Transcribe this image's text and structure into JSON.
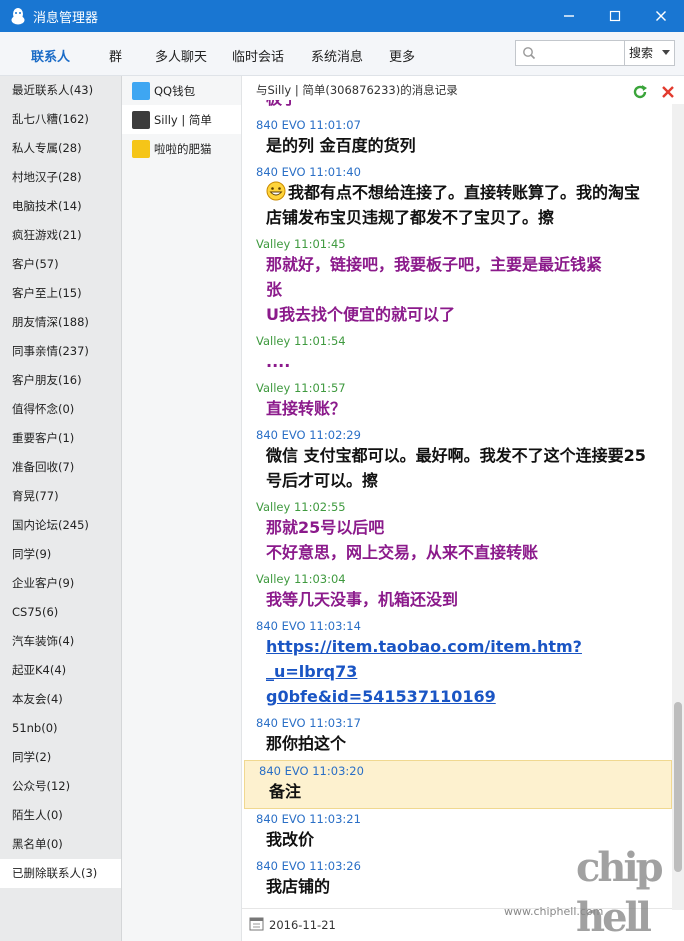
{
  "window": {
    "title": "消息管理器",
    "minimize": "—",
    "restore": "❐",
    "close": "✕"
  },
  "toolbar": {
    "tabs": [
      "联系人",
      "群",
      "多人聊天",
      "临时会话",
      "系统消息",
      "更多"
    ],
    "search_placeholder": "",
    "search_button": "搜索"
  },
  "groups": [
    "最近联系人(43)",
    "乱七八糟(162)",
    "私人专属(28)",
    "村地汉子(28)",
    "电脑技术(14)",
    "疯狂游戏(21)",
    "客户(57)",
    "客户至上(15)",
    "朋友情深(188)",
    "同事亲情(237)",
    "客户朋友(16)",
    "值得怀念(0)",
    "重要客户(1)",
    "准备回收(7)",
    "育晃(77)",
    "国内论坛(245)",
    "同学(9)",
    "企业客户(9)",
    "CS75(6)",
    "汽车装饰(4)",
    "起亚K4(4)",
    "本友会(4)",
    "51nb(0)",
    "同学(2)",
    "公众号(12)",
    "陌生人(0)",
    "黑名单(0)",
    "已删除联系人(3)"
  ],
  "contacts": [
    {
      "name": "QQ钱包",
      "avatar_color": "#3ea6f2"
    },
    {
      "name": "Silly | 简单",
      "avatar_color": "#3c3c3c"
    },
    {
      "name": "啦啦的肥猫",
      "avatar_color": "#f5c518"
    }
  ],
  "chat": {
    "header": "与Silly | 简单(306876233)的消息记录",
    "partial_top": "板子",
    "messages": [
      {
        "meta": "840 EVO 11:01:07",
        "sender": "evo",
        "lines": [
          "是的列 金百度的货列"
        ]
      },
      {
        "meta": "840 EVO 11:01:40",
        "sender": "evo",
        "emoji": "grin-emoji",
        "lines": [
          "我都有点不想给连接了。直接转账算了。我的淘宝",
          "店铺发布宝贝违规了都发不了宝贝了。擦"
        ]
      },
      {
        "meta": "Valley 11:01:45",
        "sender": "valley",
        "lines": [
          "那就好，链接吧，我要板子吧，主要是最近钱紧",
          "张",
          "U我去找个便宜的就可以了"
        ]
      },
      {
        "meta": "Valley 11:01:54",
        "sender": "valley",
        "lines": [
          "...."
        ]
      },
      {
        "meta": "Valley 11:01:57",
        "sender": "valley",
        "lines": [
          "直接转账？"
        ]
      },
      {
        "meta": "840 EVO 11:02:29",
        "sender": "evo",
        "lines": [
          "微信 支付宝都可以。最好啊。我发不了这个连接要25",
          "号后才可以。擦"
        ]
      },
      {
        "meta": "Valley 11:02:55",
        "sender": "valley",
        "lines": [
          "那就25号以后吧",
          "不好意思，网上交易，从来不直接转账"
        ]
      },
      {
        "meta": "Valley 11:03:04",
        "sender": "valley",
        "lines": [
          "我等几天没事，机箱还没到"
        ]
      },
      {
        "meta": "840 EVO 11:03:14",
        "sender": "evo",
        "link": true,
        "lines": [
          " https://item.taobao.com/item.htm?_u=lbrq73",
          "g0bfe&id=541537110169"
        ]
      },
      {
        "meta": "840 EVO 11:03:17",
        "sender": "evo",
        "lines": [
          "那你拍这个"
        ]
      },
      {
        "meta": "840 EVO 11:03:20",
        "sender": "evo",
        "highlight": true,
        "lines": [
          "备注"
        ]
      },
      {
        "meta": "840 EVO 11:03:21",
        "sender": "evo",
        "lines": [
          "我改价"
        ]
      },
      {
        "meta": "840 EVO 11:03:26",
        "sender": "evo",
        "lines": [
          "我店铺的"
        ]
      }
    ],
    "date": "2016-11-21"
  },
  "colors": {
    "titlebar": "#1976d2",
    "evo_meta": "#2a6fc6",
    "valley_meta": "#3f9a3f",
    "valley_text": "#8b1a8b",
    "link": "#1a55c4",
    "highlight": "#fdf1cf"
  },
  "watermark": {
    "logo": "chip hell",
    "url": "www.chiphell.com"
  }
}
